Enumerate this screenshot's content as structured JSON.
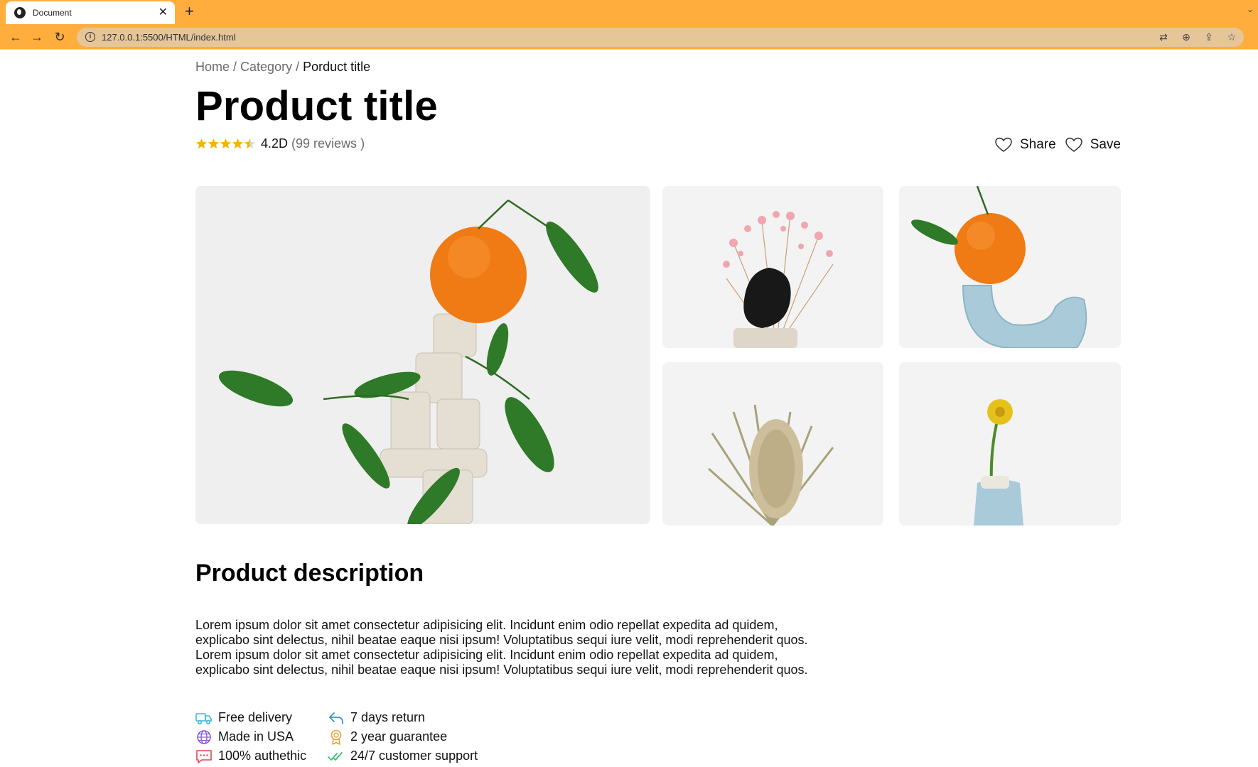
{
  "browser": {
    "tab_title": "Document",
    "new_tab": "+",
    "url": "127.0.0.1:5500/HTML/index.html"
  },
  "breadcrumb": {
    "home": "Home",
    "sep1": " / ",
    "category": "Category",
    "sep2": " / ",
    "current": "Porduct title"
  },
  "product": {
    "title": "Product title",
    "rating_value": "4.2D",
    "reviews_label": "(99 reviews )",
    "rating_stars": 4.5
  },
  "actions": {
    "share_label": "Share",
    "save_label": "Save"
  },
  "description": {
    "heading": "Product description",
    "text": "Lorem ipsum dolor sit amet consectetur adipisicing elit. Incidunt enim odio repellat expedita ad quidem, explicabo sint delectus, nihil beatae eaque nisi ipsum! Voluptatibus sequi iure velit, modi reprehenderit quos. Lorem ipsum dolor sit amet consectetur adipisicing elit. Incidunt enim odio repellat expedita ad quidem, explicabo sint delectus, nihil beatae eaque nisi ipsum! Voluptatibus sequi iure velit, modi reprehenderit quos."
  },
  "features": [
    {
      "label": "Free delivery",
      "icon": "truck-icon",
      "color": "#3bb8d9"
    },
    {
      "label": "7 days return",
      "icon": "return-arrow-icon",
      "color": "#3b8fd9"
    },
    {
      "label": "Made in USA",
      "icon": "globe-icon",
      "color": "#8a5bd9"
    },
    {
      "label": "2 year guarantee",
      "icon": "award-icon",
      "color": "#f0a030"
    },
    {
      "label": "100% authethic",
      "icon": "message-icon",
      "color": "#e0455a"
    },
    {
      "label": "24/7 customer support",
      "icon": "double-check-icon",
      "color": "#3bbf70"
    }
  ],
  "colors": {
    "browser_accent": "#ffad3d",
    "star": "#f5b400"
  }
}
